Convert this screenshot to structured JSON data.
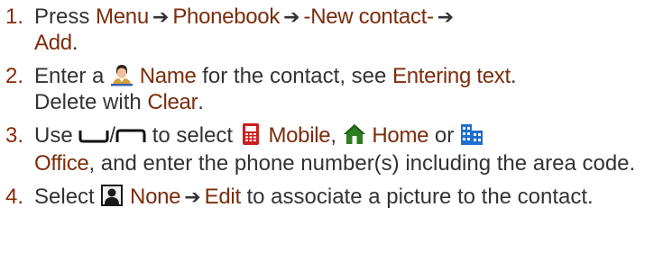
{
  "steps": [
    {
      "number": "1.",
      "t1": "Press",
      "menu": "Menu",
      "arrow1": "➔",
      "phonebook": "Phonebook",
      "arrow2": "➔",
      "new_contact": "-New contact-",
      "arrow3": "➔",
      "add": "Add",
      "end": "."
    },
    {
      "number": "2.",
      "t1": "Enter a",
      "icon": "person-name-icon",
      "name": "Name",
      "t2": "for the contact, see",
      "entering_text": "Entering text",
      "end1": ".",
      "t3": "Delete with",
      "clear": "Clear",
      "end2": "."
    },
    {
      "number": "3.",
      "t1": "Use",
      "nav_icons": [
        "nav-down-arc-icon",
        "nav-up-arc-icon"
      ],
      "slash": "/",
      "t2": "to select",
      "mobile_icon": "mobile-phone-icon",
      "mobile": "Mobile",
      "sep1": ",",
      "home_icon": "home-icon",
      "home": "Home",
      "t3": "or",
      "office_icon": "office-building-icon",
      "office": "Office",
      "t4": ", and enter the phone number(s) including the area code."
    },
    {
      "number": "4.",
      "t1": "Select",
      "picture_icon": "contact-picture-icon",
      "none": "None",
      "arrow": "➔",
      "edit": "Edit",
      "t2": "to associate a picture to the contact."
    }
  ],
  "colors": {
    "emphasis": "#7b2d0c",
    "number": "#8a2a0a",
    "text": "#333333"
  }
}
